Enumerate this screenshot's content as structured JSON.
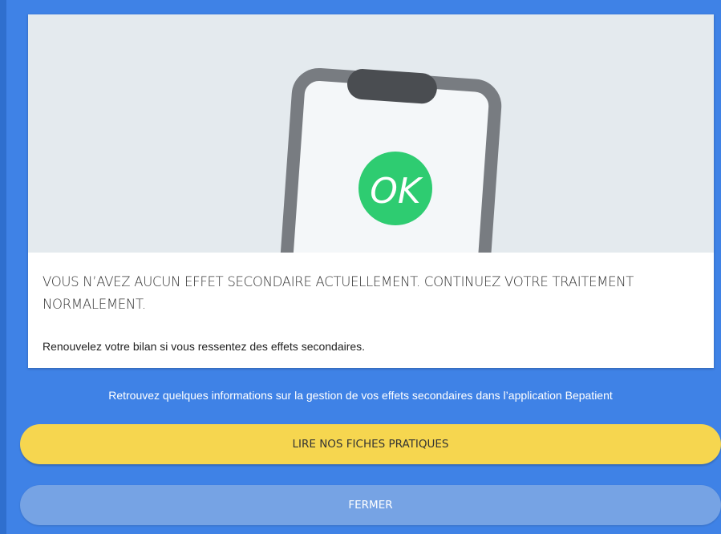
{
  "result_card": {
    "badge_text": "OK",
    "title": "VOUS N’AVEZ AUCUN EFFET SECONDAIRE ACTUELLEMENT. CONTINUEZ VOTRE TRAITEMENT NORMALEMENT.",
    "subtitle": "Renouvelez votre bilan si vous ressentez des effets secondaires."
  },
  "info": {
    "text": "Retrouvez quelques informations sur la gestion de vos effets secondaires dans l’application Bepatient"
  },
  "actions": {
    "read_sheets_label": "LIRE NOS FICHES PRATIQUES",
    "close_label": "FERMER"
  },
  "icons": {
    "illustration": "clipboard-icon",
    "badge": "ok-badge-icon"
  },
  "colors": {
    "background": "#3f82e6",
    "primary_button": "#f6d64f",
    "secondary_button": "#76a3e4",
    "ok_badge": "#2ecc71",
    "clipboard_frame": "#787c81",
    "clipboard_clip": "#4a4d51",
    "illustration_bg": "#e4eaee"
  }
}
